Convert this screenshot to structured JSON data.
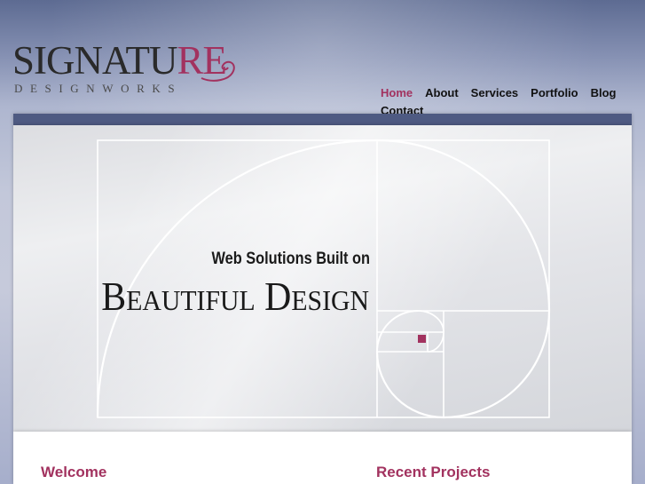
{
  "brand": {
    "name_main": "SIGNATU",
    "name_accent": "RE",
    "tagline": "DESIGNWORKS",
    "accent_color": "#a2325f"
  },
  "nav": {
    "items": [
      {
        "label": "Home",
        "active": true
      },
      {
        "label": "About"
      },
      {
        "label": "Services"
      },
      {
        "label": "Portfolio"
      },
      {
        "label": "Blog"
      },
      {
        "label": "Contact"
      }
    ]
  },
  "hero": {
    "line1": "Web Solutions Built on",
    "line2": "Beautiful Design"
  },
  "sections": {
    "welcome": "Welcome",
    "recent_projects": "Recent Projects"
  },
  "colors": {
    "bar": "#4e5a82",
    "heading": "#a2325f",
    "text": "#1a1a1a"
  }
}
